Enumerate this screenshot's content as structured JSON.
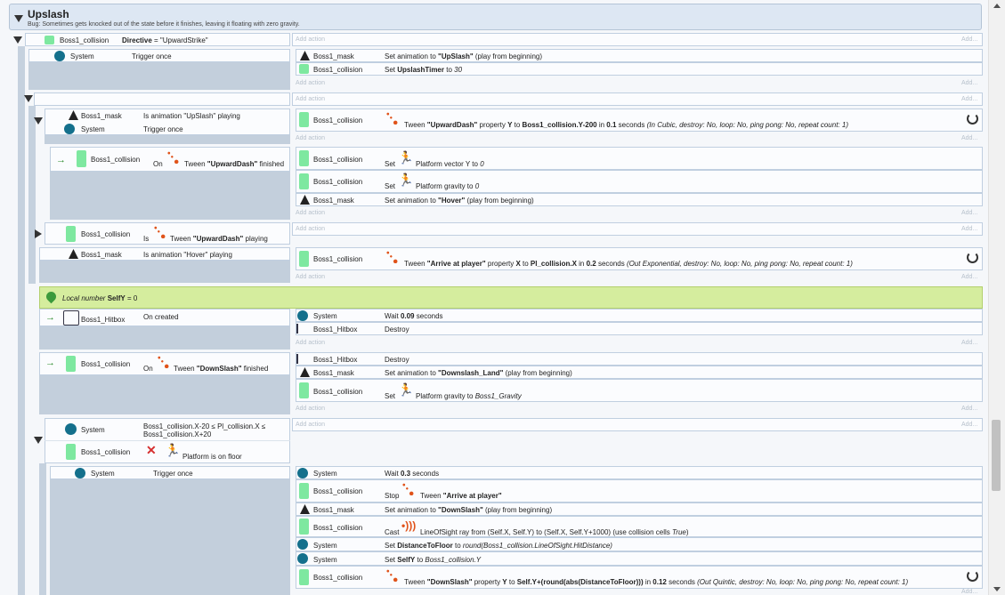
{
  "group": {
    "title": "Upslash",
    "desc": "Bug: Sometimes gets knocked out of the state before it finishes, leaving it floating with zero gravity."
  },
  "add_action": "Add action",
  "add_short": "Add...",
  "ev1": {
    "obj": "Boss1_collision",
    "cond": "Directive",
    "cond_rest": " = \"UpwardStrike\""
  },
  "ev2": {
    "obj": "System",
    "cond": "Trigger once",
    "a1_obj": "Boss1_mask",
    "a1": "Set animation to ",
    "a1b": "\"UpSlash\"",
    "a1r": " (play from beginning)",
    "a2_obj": "Boss1_collision",
    "a2": "Set ",
    "a2b": "UpslashTimer",
    "a2r": " to ",
    "a2i": "30"
  },
  "ev4": {
    "c1_obj": "Boss1_mask",
    "c1": "Is animation \"UpSlash\" playing",
    "c2_obj": "System",
    "c2": "Trigger once",
    "a_obj": "Boss1_collision",
    "a_pre": "Tween ",
    "a_b1": "\"UpwardDash\"",
    "a_m": " property ",
    "a_b2": "Y",
    "a_m2": " to ",
    "a_b3": "Boss1_collision.Y-200",
    "a_m3": " in ",
    "a_b4": "0.1",
    "a_m4": " seconds ",
    "a_i": "(In Cubic, destroy: No, loop: No, ping pong: No, repeat count: 1)"
  },
  "ev5": {
    "obj": "Boss1_collision",
    "on": "On",
    "tw": "Tween ",
    "twb": "\"UpwardDash\"",
    "twr": " finished",
    "a1_obj": "Boss1_collision",
    "a1": "Set",
    "a1r": "Platform vector Y to ",
    "a1i": "0",
    "a2_obj": "Boss1_collision",
    "a2": "Set",
    "a2r": "Platform gravity to ",
    "a2i": "0",
    "a3_obj": "Boss1_mask",
    "a3": "Set animation to ",
    "a3b": "\"Hover\"",
    "a3r": " (play from beginning)"
  },
  "ev6": {
    "obj": "Boss1_collision",
    "is": "Is",
    "tw": "Tween ",
    "twb": "\"UpwardDash\"",
    "twr": " playing"
  },
  "ev7": {
    "obj": "Boss1_mask",
    "cond": "Is animation \"Hover\" playing",
    "a_obj": "Boss1_collision",
    "a_pre": "Tween ",
    "a_b1": "\"Arrive at player\"",
    "a_m": " property ",
    "a_b2": "X",
    "a_m2": " to ",
    "a_b3": "Pl_collision.X",
    "a_m3": " in ",
    "a_b4": "0.2",
    "a_m4": " seconds ",
    "a_i": "(Out Exponential, destroy: No, loop: No, ping pong: No, repeat count: 1)"
  },
  "local": {
    "label": "Local number ",
    "name": "SelfY",
    "rest": " = 0"
  },
  "ev8": {
    "obj": "Boss1_Hitbox",
    "cond": "On created",
    "a1_obj": "System",
    "a1": "Wait ",
    "a1b": "0.09",
    "a1r": " seconds",
    "a2_obj": "Boss1_Hitbox",
    "a2": "Destroy"
  },
  "ev9": {
    "obj": "Boss1_collision",
    "on": "On",
    "tw": "Tween ",
    "twb": "\"DownSlash\"",
    "twr": " finished",
    "a1_obj": "Boss1_Hitbox",
    "a1": "Destroy",
    "a2_obj": "Boss1_mask",
    "a2": "Set animation to ",
    "a2b": "\"Downslash_Land\"",
    "a2r": " (play from beginning)",
    "a3_obj": "Boss1_collision",
    "a3": "Set",
    "a3r": "Platform gravity to ",
    "a3i": "Boss1_Gravity"
  },
  "ev10": {
    "c1_obj": "System",
    "c1a": "Boss1_collision.X-20 ≤ Pl_collision.X ≤",
    "c1b": "Boss1_collision.X+20",
    "c2_obj": "Boss1_collision",
    "c2": "Platform is on floor"
  },
  "ev11": {
    "obj": "System",
    "cond": "Trigger once",
    "a1_obj": "System",
    "a1": "Wait ",
    "a1b": "0.3",
    "a1r": " seconds",
    "a2_obj": "Boss1_collision",
    "a2": "Stop",
    "a2t": "Tween ",
    "a2b": "\"Arrive at player\"",
    "a3_obj": "Boss1_mask",
    "a3": "Set animation to ",
    "a3b": "\"DownSlash\"",
    "a3r": " (play from beginning)",
    "a4_obj": "Boss1_collision",
    "a4": "Cast",
    "a4r": "LineOfSight ray from (Self.X, Self.Y) to (Self.X, Self.Y+1000) (use collision cells ",
    "a4i": "True",
    "a5_obj": "System",
    "a5": "Set ",
    "a5b": "DistanceToFloor",
    "a5r": " to ",
    "a5i": "round(Boss1_collision.LineOfSight.HitDistance)",
    "a6_obj": "System",
    "a6": "Set ",
    "a6b": "SelfY",
    "a6r": " to ",
    "a6i": "Boss1_collision.Y",
    "a7_obj": "Boss1_collision",
    "a7_pre": "Tween ",
    "a7b1": "\"DownSlash\"",
    "a7m": " property ",
    "a7b2": "Y",
    "a7m2": " to ",
    "a7b3": "Self.Y+(round(abs(DistanceToFloor)))",
    "a7m3": " in ",
    "a7b4": "0.12",
    "a7m4": " seconds ",
    "a7i": "(Out Quintic, destroy: No, loop: No, ping pong: No, repeat count: 1)"
  },
  "icons": [
    "collapse-icon",
    "gear-icon",
    "mask-icon",
    "tween-icon",
    "platform-icon",
    "raycast-icon",
    "trigger-arrow-icon",
    "local-var-icon",
    "x-icon",
    "refresh-icon"
  ]
}
